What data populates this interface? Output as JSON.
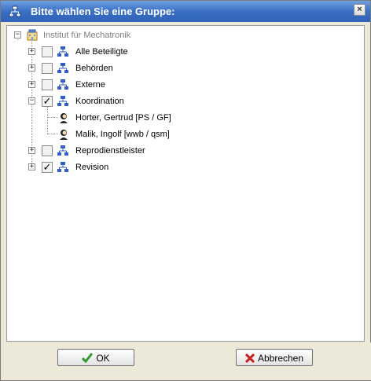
{
  "window": {
    "title": "Bitte wählen Sie eine Gruppe:",
    "close_glyph": "×",
    "title_icon": "org-chart-icon",
    "accent": "#3a6fc4"
  },
  "tree": {
    "root": {
      "label": "Institut für Mechatronik",
      "icon": "building-icon",
      "expanded": true
    },
    "nodes": [
      {
        "label": "Alle Beteiligte",
        "checked": false,
        "expanded": false,
        "icon": "org-chart-icon"
      },
      {
        "label": "Behörden",
        "checked": false,
        "expanded": false,
        "icon": "org-chart-icon"
      },
      {
        "label": "Externe",
        "checked": false,
        "expanded": false,
        "icon": "org-chart-icon"
      },
      {
        "label": "Koordination",
        "checked": true,
        "expanded": true,
        "icon": "org-chart-icon",
        "children": [
          {
            "label": "Horter, Gertrud [PS / GF]",
            "icon": "person-icon"
          },
          {
            "label": "Malik, Ingolf [wwb / qsm]",
            "icon": "person-icon"
          }
        ]
      },
      {
        "label": "Reprodienstleister",
        "checked": false,
        "expanded": false,
        "icon": "org-chart-icon"
      },
      {
        "label": "Revision",
        "checked": true,
        "expanded": false,
        "icon": "org-chart-icon"
      }
    ]
  },
  "buttons": {
    "ok_label": "OK",
    "cancel_label": "Abbrechen",
    "ok_icon": "checkmark-icon",
    "cancel_icon": "x-icon"
  },
  "glyphs": {
    "expand": "+",
    "collapse": "−",
    "check": "✓"
  }
}
